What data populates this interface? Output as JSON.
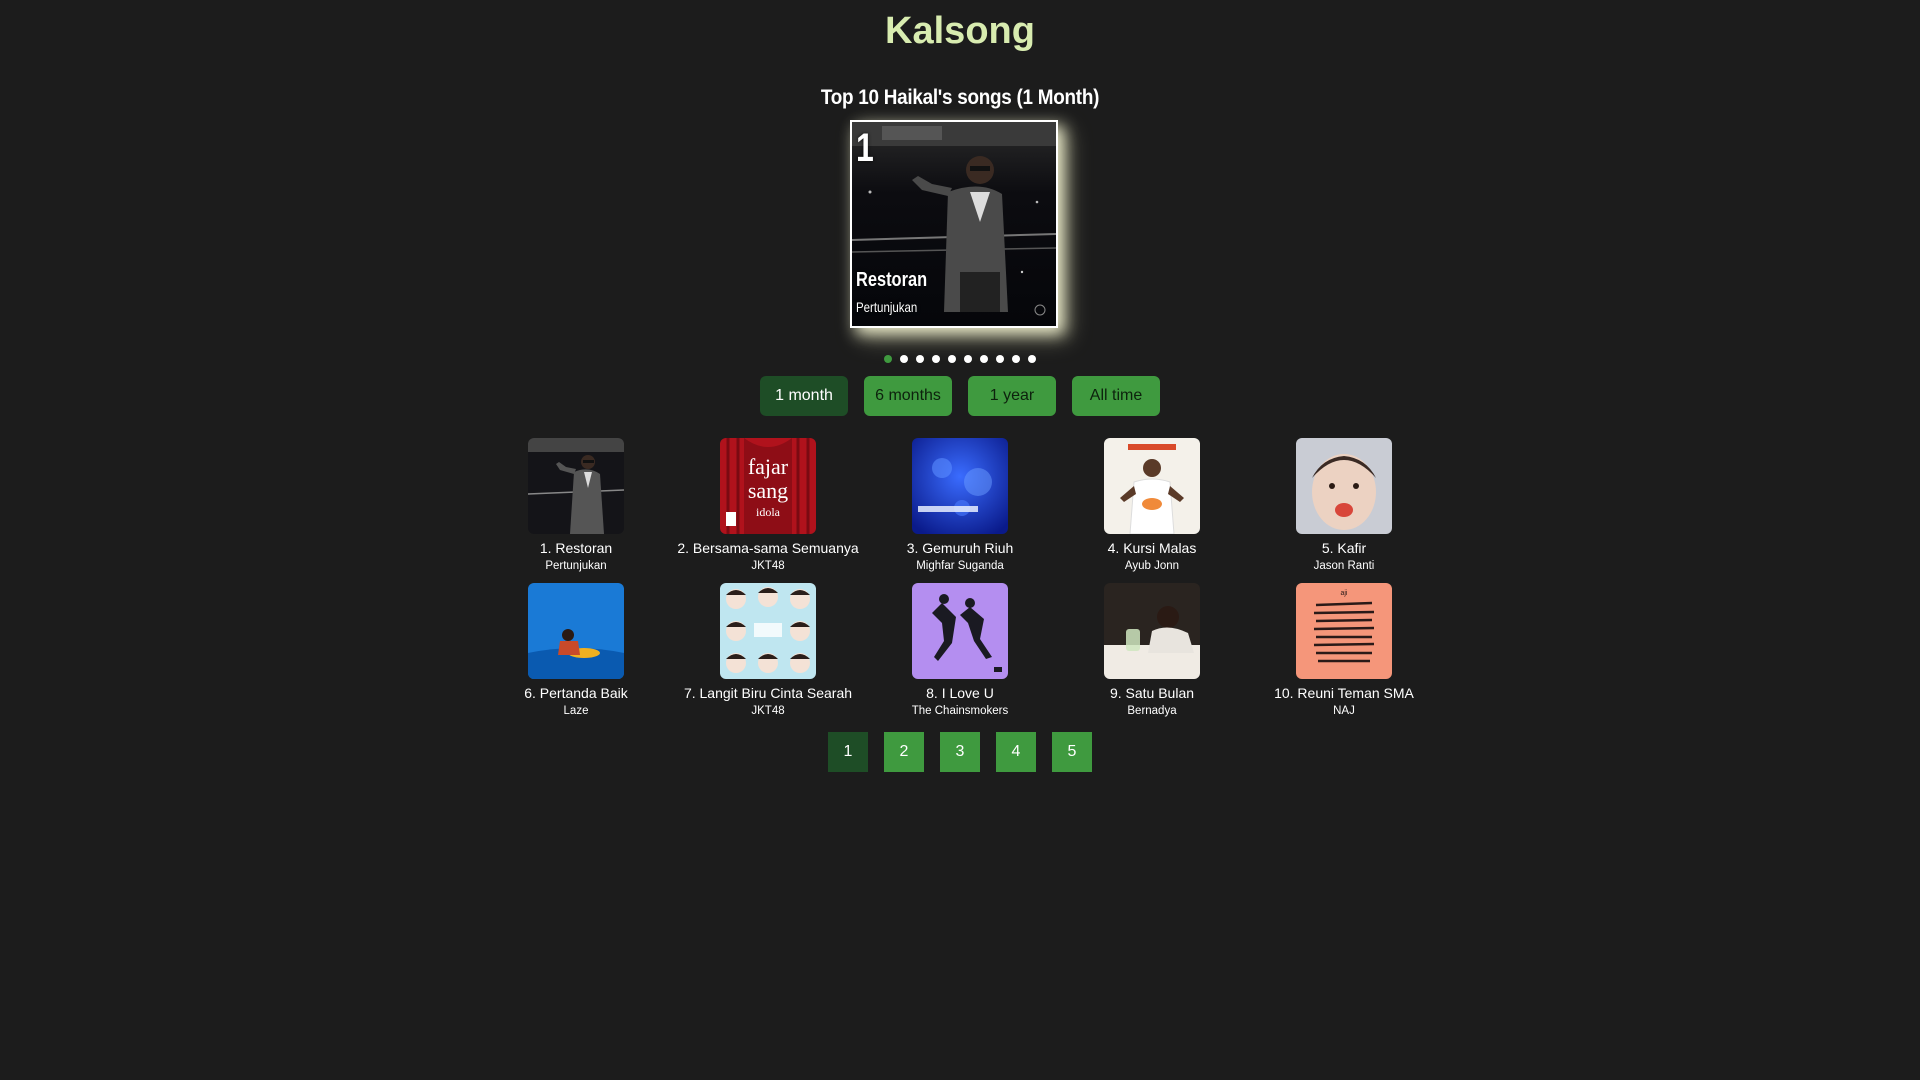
{
  "brand": "Kalsong",
  "section_title": "Top 10 Haikal's songs (1 Month)",
  "colors": {
    "background": "#1c1c1c",
    "brand": "#d8ecb0",
    "accent_green": "#3f9a3f",
    "active_green": "#1e4d26"
  },
  "carousel": {
    "rank": "1",
    "title": "Restoran",
    "artist": "Pertunjukan",
    "slide_count": 10,
    "active_slide": 1
  },
  "periods": [
    {
      "label": "1 month",
      "active": true
    },
    {
      "label": "6 months",
      "active": false
    },
    {
      "label": "1 year",
      "active": false
    },
    {
      "label": "All time",
      "active": false
    }
  ],
  "songs": [
    {
      "title": "1. Restoran",
      "artist": "Pertunjukan",
      "cover_icon": "person-night-photo"
    },
    {
      "title": "2. Bersama-sama Semuanya",
      "artist": "JKT48",
      "cover_icon": "red-curtain-stage"
    },
    {
      "title": "3. Gemuruh Riuh",
      "artist": "Mighfar Suganda",
      "cover_icon": "blue-abstract"
    },
    {
      "title": "4. Kursi Malas",
      "artist": "Ayub Jonn",
      "cover_icon": "man-white-shirt"
    },
    {
      "title": "5. Kafir",
      "artist": "Jason Ranti",
      "cover_icon": "baby-face"
    },
    {
      "title": "6. Pertanda Baik",
      "artist": "Laze",
      "cover_icon": "blue-scene"
    },
    {
      "title": "7. Langit Biru Cinta Searah",
      "artist": "JKT48",
      "cover_icon": "group-portraits"
    },
    {
      "title": "8. I Love U",
      "artist": "The Chainsmokers",
      "cover_icon": "purple-jumping-figures"
    },
    {
      "title": "9. Satu Bulan",
      "artist": "Bernadya",
      "cover_icon": "woman-at-table"
    },
    {
      "title": "10. Reuni Teman SMA",
      "artist": "NAJ",
      "cover_icon": "salmon-scribbles"
    }
  ],
  "pagination": [
    {
      "label": "1",
      "active": true
    },
    {
      "label": "2",
      "active": false
    },
    {
      "label": "3",
      "active": false
    },
    {
      "label": "4",
      "active": false
    },
    {
      "label": "5",
      "active": false
    }
  ]
}
